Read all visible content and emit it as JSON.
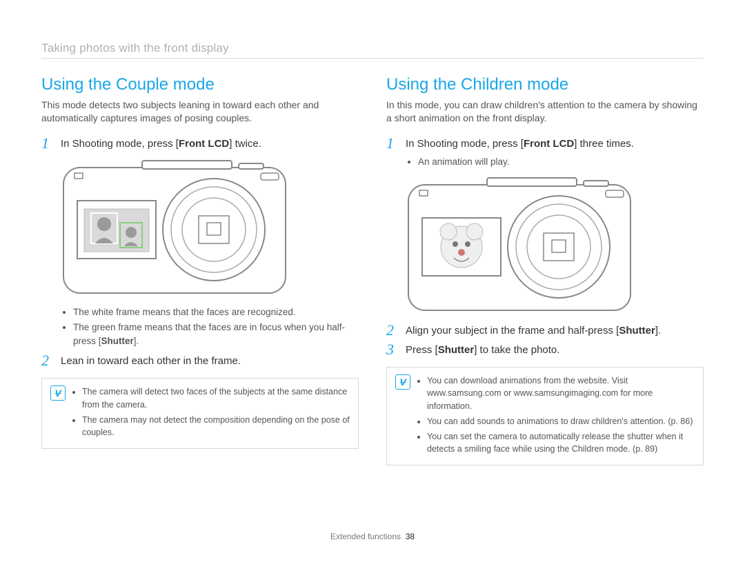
{
  "breadcrumb": "Taking photos with the front display",
  "left": {
    "heading": "Using the Couple mode",
    "intro": "This mode detects two subjects leaning in toward each other and automatically captures images of posing couples.",
    "step1_num": "1",
    "step1_pre": "In Shooting mode, press [",
    "step1_bold": "Front LCD",
    "step1_post": "] twice.",
    "bullets": {
      "b1": "The white frame means that the faces are recognized.",
      "b2_pre": "The green frame means that the faces are in focus when you half-press [",
      "b2_bold": "Shutter",
      "b2_post": "]."
    },
    "step2_num": "2",
    "step2_text": "Lean in toward each other in the frame.",
    "note": {
      "n1": "The camera will detect two faces of the subjects at the same distance from the camera.",
      "n2": "The camera may not detect the composition depending on the pose of couples."
    }
  },
  "right": {
    "heading": "Using the Children mode",
    "intro": "In this mode, you can draw children's attention to the camera by showing a short animation on the front display.",
    "step1_num": "1",
    "step1_pre": "In Shooting mode, press [",
    "step1_bold": "Front LCD",
    "step1_post": "] three times.",
    "sub1": "An animation will play.",
    "step2_num": "2",
    "step2_pre": "Align your subject in the frame and half-press [",
    "step2_bold": "Shutter",
    "step2_post": "].",
    "step3_num": "3",
    "step3_pre": "Press [",
    "step3_bold": "Shutter",
    "step3_post": "] to take the photo.",
    "note": {
      "n1": "You can download animations from the website. Visit www.samsung.com or www.samsungimaging.com for more information.",
      "n2": "You can add sounds to animations to draw children's attention. (p. 86)",
      "n3": "You can set the camera to automatically release the shutter when it detects a smiling face while using the Children mode. (p. 89)"
    }
  },
  "footer_label": "Extended functions",
  "footer_page": "38"
}
